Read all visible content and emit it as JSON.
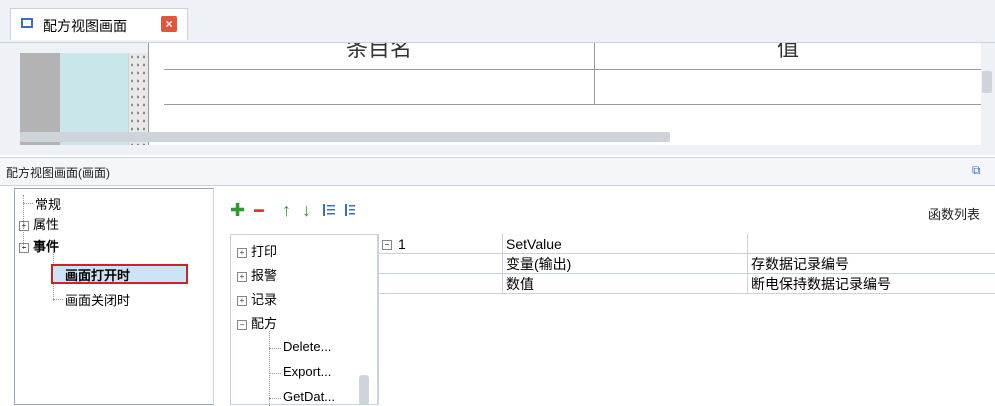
{
  "tab": {
    "label": "配方视图画面",
    "close": "×"
  },
  "preview": {
    "col1_header": "条目名",
    "col2_header": "值"
  },
  "panel": {
    "title": "配方视图画面(画面)",
    "pin": "⧉"
  },
  "tree": {
    "items": [
      {
        "label": "常规"
      },
      {
        "label": "属性",
        "toggle": "+"
      },
      {
        "label": "事件",
        "toggle": "−"
      },
      {
        "label": "画面打开时"
      },
      {
        "label": "画面关闭时"
      }
    ]
  },
  "toolbar": {
    "add": "✚",
    "remove": "━",
    "up": "↑",
    "down": "↓",
    "list_label": "函数列表"
  },
  "functions": {
    "items": [
      {
        "label": "打印",
        "toggle": "+"
      },
      {
        "label": "报警",
        "toggle": "+"
      },
      {
        "label": "记录",
        "toggle": "+"
      },
      {
        "label": "配方",
        "toggle": "−"
      },
      {
        "label": "Delete..."
      },
      {
        "label": "Export..."
      },
      {
        "label": "GetDat..."
      }
    ]
  },
  "grid": {
    "rows": [
      {
        "index": "1",
        "toggle": "−",
        "name": "SetValue",
        "value": ""
      },
      {
        "index": "",
        "toggle": "",
        "name": "变量(输出)",
        "value": "存数据记录编号"
      },
      {
        "index": "",
        "toggle": "",
        "name": "数值",
        "value": "断电保持数据记录编号"
      }
    ]
  },
  "colors": {
    "accent": "#3b6fb6",
    "selection": "#cce4f7",
    "highlight_border": "#d0202a",
    "close": "#e0553d"
  }
}
